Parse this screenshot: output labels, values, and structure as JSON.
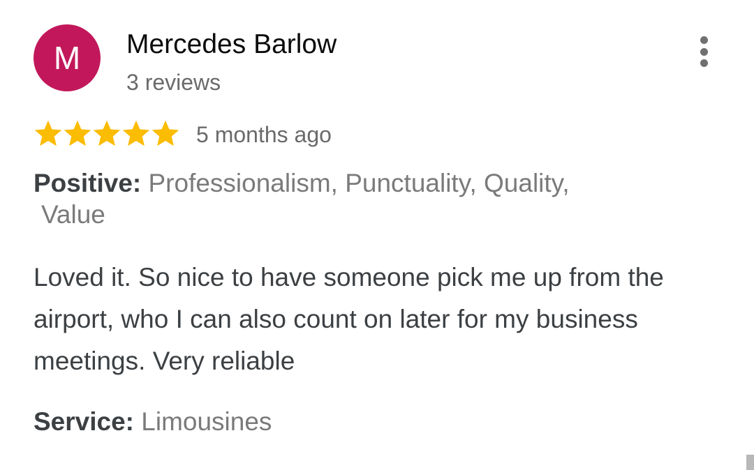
{
  "review": {
    "avatar": {
      "initial": "M",
      "color": "#c2185b"
    },
    "author": "Mercedes Barlow",
    "review_count": "3 reviews",
    "rating": 5,
    "max_rating": 5,
    "star_color": "#fbbc04",
    "date": "5 months ago",
    "positive": {
      "label": "Positive:",
      "values_line1": "Professionalism, Punctuality, Quality,",
      "values_line2": "Value"
    },
    "text": "Loved it. So nice to have someone pick me up from the airport, who I can also count on later for my business meetings. Very reliable",
    "service": {
      "label": "Service:",
      "value": "Limousines"
    },
    "menu_icon": "more-vert-icon"
  }
}
